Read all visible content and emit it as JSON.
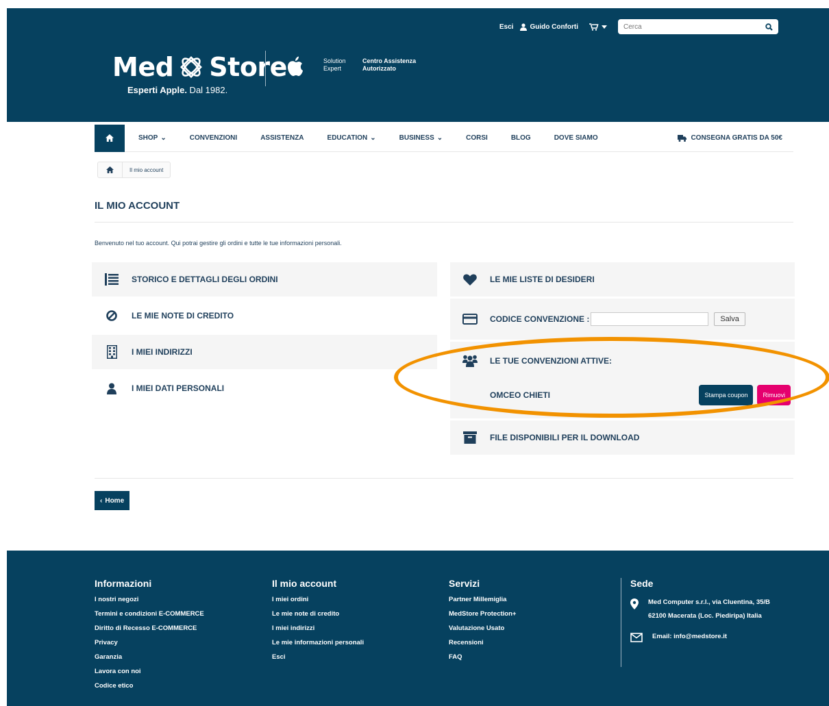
{
  "topbar": {
    "logout": "Esci",
    "user_name": "Guido Conforti",
    "search_placeholder": "Cerca"
  },
  "brand": {
    "name_left": "Med",
    "name_right": "Store",
    "tagline_bold": "Esperti Apple.",
    "tagline_rest": " Dal 1982.",
    "solution_line1": "Solution",
    "solution_line2": "Expert",
    "centro_line1": "Centro Assistenza",
    "centro_line2": "Autorizzato"
  },
  "nav": {
    "items": [
      "SHOP",
      "CONVENZIONI",
      "ASSISTENZA",
      "EDUCATION",
      "BUSINESS",
      "CORSI",
      "BLOG",
      "DOVE SIAMO"
    ],
    "free_shipping": "CONSEGNA GRATIS DA 50€"
  },
  "breadcrumb": {
    "current": "Il mio account"
  },
  "page": {
    "title": "IL MIO ACCOUNT",
    "welcome": "Benvenuto nel tuo account. Qui potrai gestire gli ordini e tutte le tue informazioni personali."
  },
  "left_menu": [
    {
      "label": "STORICO E DETTAGLI DEGLI ORDINI"
    },
    {
      "label": "LE MIE NOTE DI CREDITO"
    },
    {
      "label": "I MIEI INDIRIZZI"
    },
    {
      "label": "I MIEI DATI PERSONALI"
    }
  ],
  "right_menu": {
    "wishlist": "LE MIE LISTE DI DESIDERI",
    "coupon_label": "CODICE CONVENZIONE :",
    "coupon_value": "",
    "save_label": "Salva",
    "active_label": "LE TUE CONVENZIONI ATTIVE:",
    "active_name": "OMCEO CHIETI",
    "print_label": "Stampa coupon",
    "remove_label": "Rimuovi",
    "downloads": "FILE DISPONIBILI PER IL DOWNLOAD"
  },
  "back_button": "Home",
  "footer": {
    "info_title": "Informazioni",
    "info_links": [
      "I nostri negozi",
      "Termini e condizioni E-COMMERCE",
      "Diritto di Recesso E-COMMERCE",
      "Privacy",
      "Garanzia",
      "Lavora con noi",
      "Codice etico"
    ],
    "account_title": "Il mio account",
    "account_links": [
      "I miei ordini",
      "Le mie note di credito",
      "I miei indirizzi",
      "Le mie informazioni personali",
      "Esci"
    ],
    "services_title": "Servizi",
    "services_links": [
      "Partner Millemiglia",
      "MedStore Protection+",
      "Valutazione Usato",
      "Recensioni",
      "FAQ"
    ],
    "sede_title": "Sede",
    "address_line1": "Med Computer s.r.l., via Cluentina, 35/B",
    "address_line2": "62100 Macerata (Loc. Piediripa) Italia",
    "email": "Email: info@medstore.it"
  },
  "colors": {
    "brand_blue": "#06415f",
    "accent_pink": "#e5006e",
    "highlight_orange": "#f29200"
  }
}
